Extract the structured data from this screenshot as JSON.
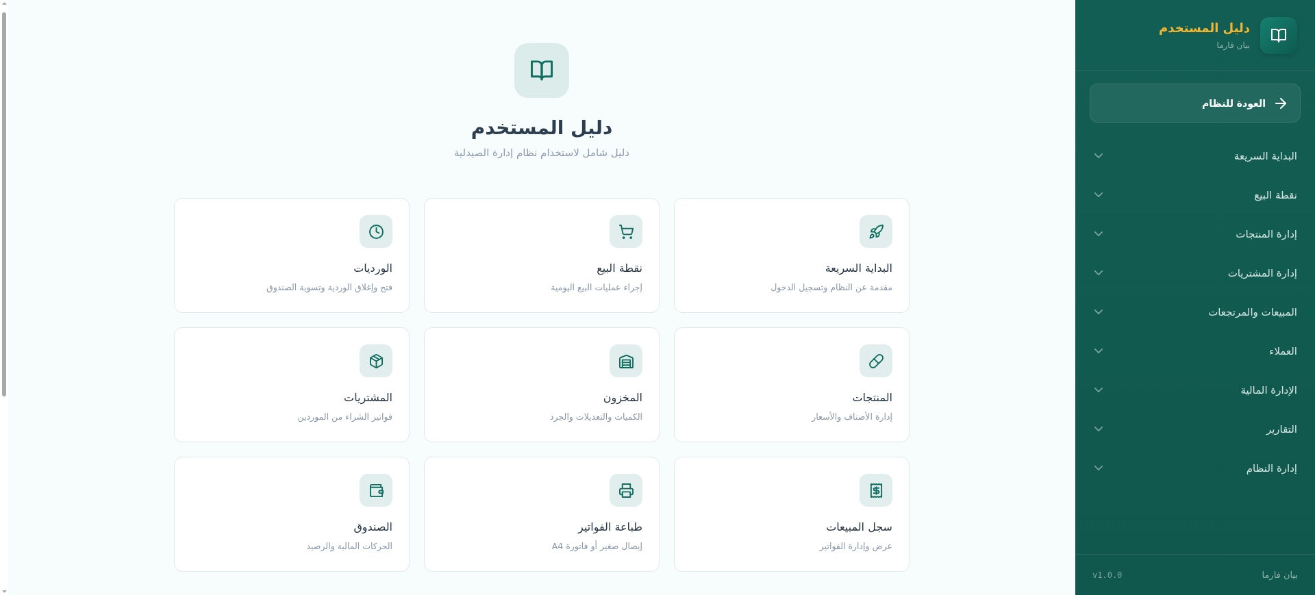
{
  "sidebar": {
    "header": {
      "title": "دليل المستخدم",
      "subtitle": "بيان فارما"
    },
    "back_button": {
      "label": "العودة للنظام"
    },
    "items": [
      {
        "label": "البداية السريعة",
        "expanded": false
      },
      {
        "label": "نقطة البيع",
        "expanded": false
      },
      {
        "label": "إدارة المنتجات",
        "expanded": false
      },
      {
        "label": "إدارة المشتريات",
        "expanded": false
      },
      {
        "label": "المبيعات والمرتجعات",
        "expanded": false
      },
      {
        "label": "العملاء",
        "expanded": false
      },
      {
        "label": "الإدارة المالية",
        "expanded": false
      },
      {
        "label": "التقارير",
        "expanded": false
      },
      {
        "label": "إدارة النظام",
        "expanded": false
      }
    ],
    "footer": {
      "brand": "بيان فارما",
      "version": "v1.0.0"
    }
  },
  "main": {
    "header": {
      "title": "دليل المستخدم",
      "subtitle": "دليل شامل لاستخدام نظام إدارة الصيدلية"
    },
    "cards": [
      {
        "title": "البداية السريعة",
        "description": "مقدمة عن النظام وتسجيل الدخول"
      },
      {
        "title": "نقطة البيع",
        "description": "إجراء عمليات البيع اليومية"
      },
      {
        "title": "الورديات",
        "description": "فتح وإغلاق الوردية وتسوية الصندوق"
      },
      {
        "title": "المنتجات",
        "description": "إدارة الأصناف والأسعار"
      },
      {
        "title": "المخزون",
        "description": "الكميات والتعديلات والجرد"
      },
      {
        "title": "المشتريات",
        "description": "فواتير الشراء من الموردين"
      },
      {
        "title": "سجل المبيعات",
        "description": "عرض وإدارة الفواتير"
      },
      {
        "title": "طباعة الفواتير",
        "description": "إيصال صغير أو فاتورة A4"
      },
      {
        "title": "الصندوق",
        "description": "الحركات المالية والرصيد"
      }
    ]
  }
}
